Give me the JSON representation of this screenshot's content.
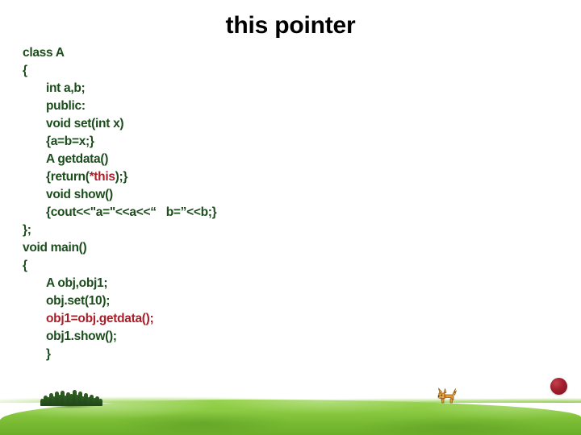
{
  "slide": {
    "title": "this pointer",
    "background_color": "#ffffff",
    "code_color_green": "#1c4d1c",
    "code_color_red": "#a81f2a",
    "title_color": "#000000"
  },
  "code": {
    "lines": [
      {
        "indent": false,
        "text": "class A"
      },
      {
        "indent": false,
        "text": "{"
      },
      {
        "indent": true,
        "text": "int a,b;"
      },
      {
        "indent": true,
        "text": "public:"
      },
      {
        "indent": true,
        "text": "void set(int x)"
      },
      {
        "indent": true,
        "text": "{a=b=x;}"
      },
      {
        "indent": true,
        "text": "A getdata()"
      },
      {
        "indent": true,
        "text": "{return(*this);}",
        "segments": [
          {
            "text": "{return(",
            "color": "green"
          },
          {
            "text": "*this",
            "color": "red"
          },
          {
            "text": ");}",
            "color": "green"
          }
        ]
      },
      {
        "indent": true,
        "text": "void show()"
      },
      {
        "indent": true,
        "text": "{cout<<\"a=\"<<a<<“   b=”<<b;}"
      },
      {
        "indent": false,
        "text": "};"
      },
      {
        "indent": false,
        "text": "void main()"
      },
      {
        "indent": false,
        "text": "{"
      },
      {
        "indent": true,
        "text": "A obj,obj1;"
      },
      {
        "indent": true,
        "text": "obj.set(10);"
      },
      {
        "indent": true,
        "text": "obj1=obj.getdata();",
        "color": "red"
      },
      {
        "indent": true,
        "text": "obj1.show();"
      },
      {
        "indent": true,
        "text": "}"
      }
    ]
  },
  "scenery": {
    "grass_color_top": "#97d24e",
    "grass_color_bottom": "#6aae28",
    "bush_color": "#2f5e22",
    "dog_color": "#e89a3c",
    "ball_color": "#a31f2e",
    "dog_label": "dog",
    "ball_label": "ball",
    "bush_label": "bushes"
  }
}
